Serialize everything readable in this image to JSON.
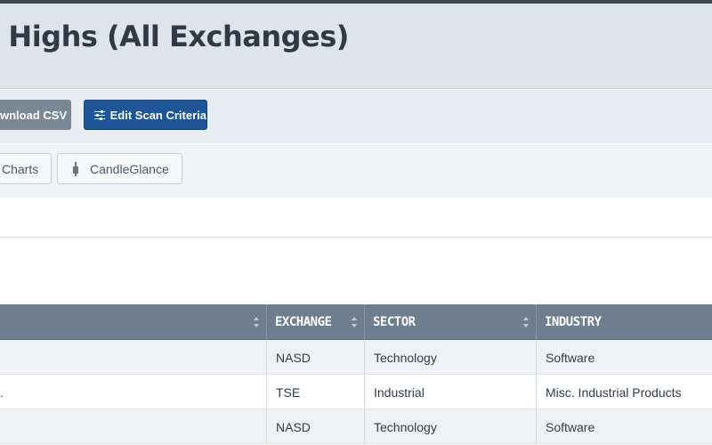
{
  "page": {
    "title": "k Highs (All Exchanges)"
  },
  "actions": {
    "download_csv": "wnload CSV",
    "edit_scan": "Edit Scan Criteria"
  },
  "views": {
    "charts": "Charts",
    "candleglance": "CandleGlance"
  },
  "table": {
    "columns": [
      "",
      "EXCHANGE",
      "SECTOR",
      "INDUSTRY"
    ],
    "rows": [
      {
        "name": "",
        "exchange": "NASD",
        "sector": "Technology",
        "industry": "Software"
      },
      {
        "name": ".",
        "exchange": "TSE",
        "sector": "Industrial",
        "industry": "Misc. Industrial Products"
      },
      {
        "name": "",
        "exchange": "NASD",
        "sector": "Technology",
        "industry": "Software"
      }
    ]
  },
  "icons": {
    "edit_scan": "sliders-icon",
    "candleglance": "candlestick-icon",
    "sort": "sort-icon"
  },
  "colors": {
    "primary_button": "#1d5596",
    "secondary_button": "#7b8794",
    "table_header": "#6e7e8e"
  }
}
